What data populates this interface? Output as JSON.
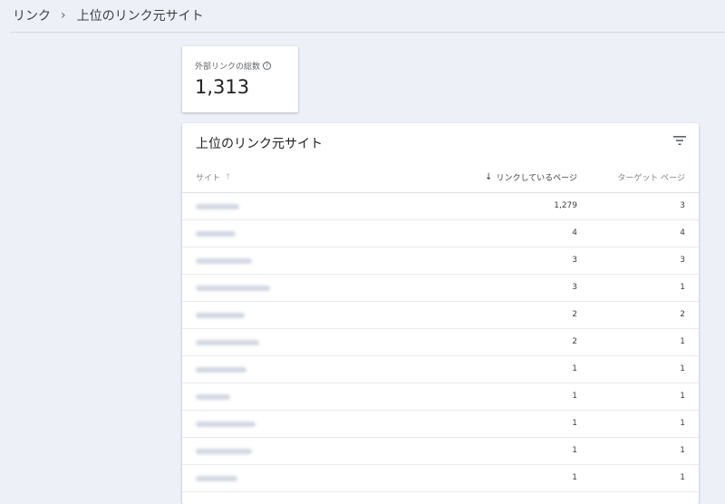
{
  "breadcrumb": {
    "items": [
      "リンク",
      "上位のリンク元サイト"
    ],
    "separator": "›"
  },
  "stat": {
    "label": "外部リンクの総数",
    "help_icon": "?",
    "value": "1,313"
  },
  "table": {
    "title": "上位のリンク元サイト",
    "filter_icon": "filter-icon",
    "columns": {
      "site": "サイト",
      "site_sort_icon": "↑",
      "linking": "リンクしているページ",
      "linking_sort_icon": "↓",
      "target": "ターゲット ページ"
    },
    "rows": [
      {
        "site": "",
        "linking": "1,279",
        "target": "3"
      },
      {
        "site": "",
        "linking": "4",
        "target": "4"
      },
      {
        "site": "",
        "linking": "3",
        "target": "3"
      },
      {
        "site": "",
        "linking": "3",
        "target": "1"
      },
      {
        "site": "",
        "linking": "2",
        "target": "2"
      },
      {
        "site": "",
        "linking": "2",
        "target": "1"
      },
      {
        "site": "",
        "linking": "1",
        "target": "1"
      },
      {
        "site": "",
        "linking": "1",
        "target": "1"
      },
      {
        "site": "",
        "linking": "1",
        "target": "1"
      },
      {
        "site": "",
        "linking": "1",
        "target": "1"
      },
      {
        "site": "",
        "linking": "1",
        "target": "1"
      }
    ]
  },
  "colors": {
    "background": "#eef0f8",
    "card": "#ffffff",
    "text_primary": "#202124",
    "text_secondary": "#5f6368"
  }
}
